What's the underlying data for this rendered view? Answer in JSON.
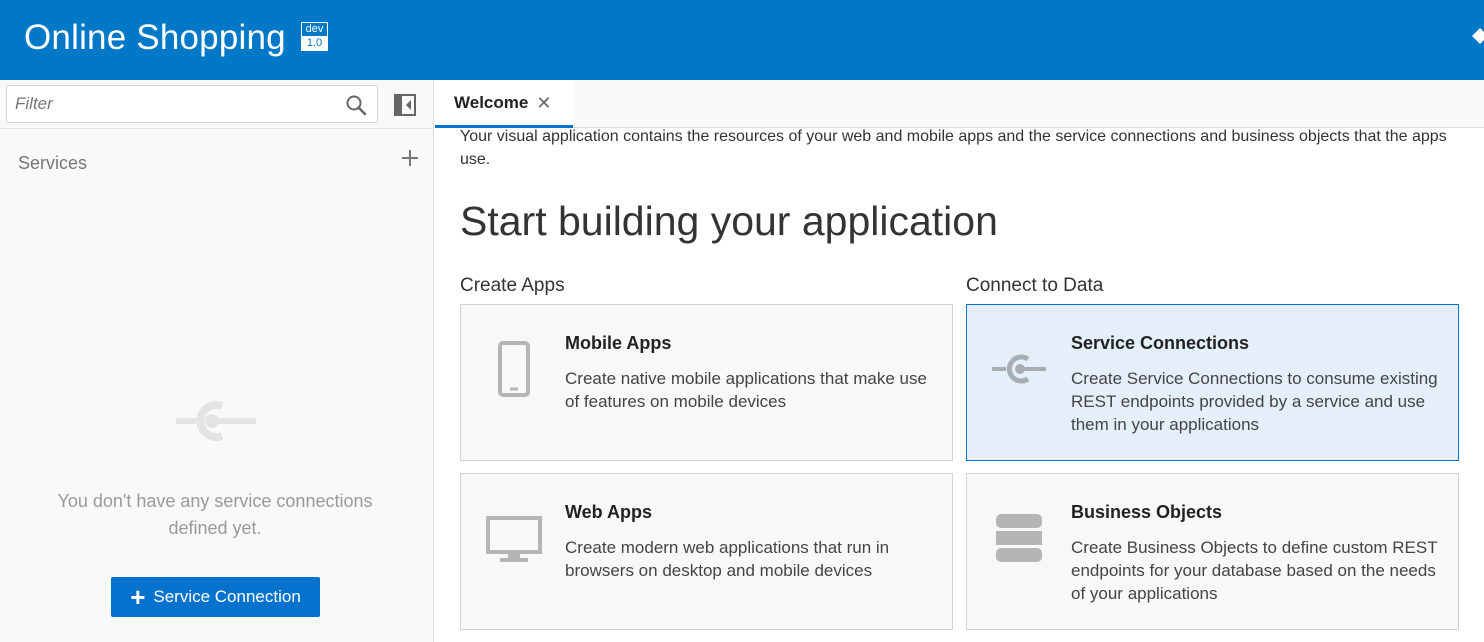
{
  "header": {
    "app_title": "Online Shopping",
    "env_badge": "dev",
    "version_badge": "1.0",
    "accent_color": "#0078c8"
  },
  "sidebar": {
    "filter_placeholder": "Filter",
    "section_title": "Services",
    "empty_message": "You don't have any service connections defined yet.",
    "add_button_label": "Service Connection"
  },
  "tabs": [
    {
      "label": "Welcome",
      "active": true
    }
  ],
  "welcome": {
    "intro": "Your visual application contains the resources of your web and mobile apps and the service connections and business objects that the apps use.",
    "headline": "Start building your application",
    "create_apps_label": "Create Apps",
    "connect_data_label": "Connect to Data",
    "cards": [
      {
        "title": "Mobile Apps",
        "description": "Create native mobile applications that make use of features on mobile devices",
        "icon": "mobile-phone-icon"
      },
      {
        "title": "Service Connections",
        "description": "Create Service Connections to consume existing REST endpoints provided by a service and use them in your applications",
        "icon": "service-connection-icon",
        "selected": true
      },
      {
        "title": "Web Apps",
        "description": "Create modern web applications that run in browsers on desktop and mobile devices",
        "icon": "desktop-monitor-icon"
      },
      {
        "title": "Business Objects",
        "description": "Create Business Objects to define custom REST endpoints for your database based on the needs of your applications",
        "icon": "database-icon"
      }
    ]
  }
}
